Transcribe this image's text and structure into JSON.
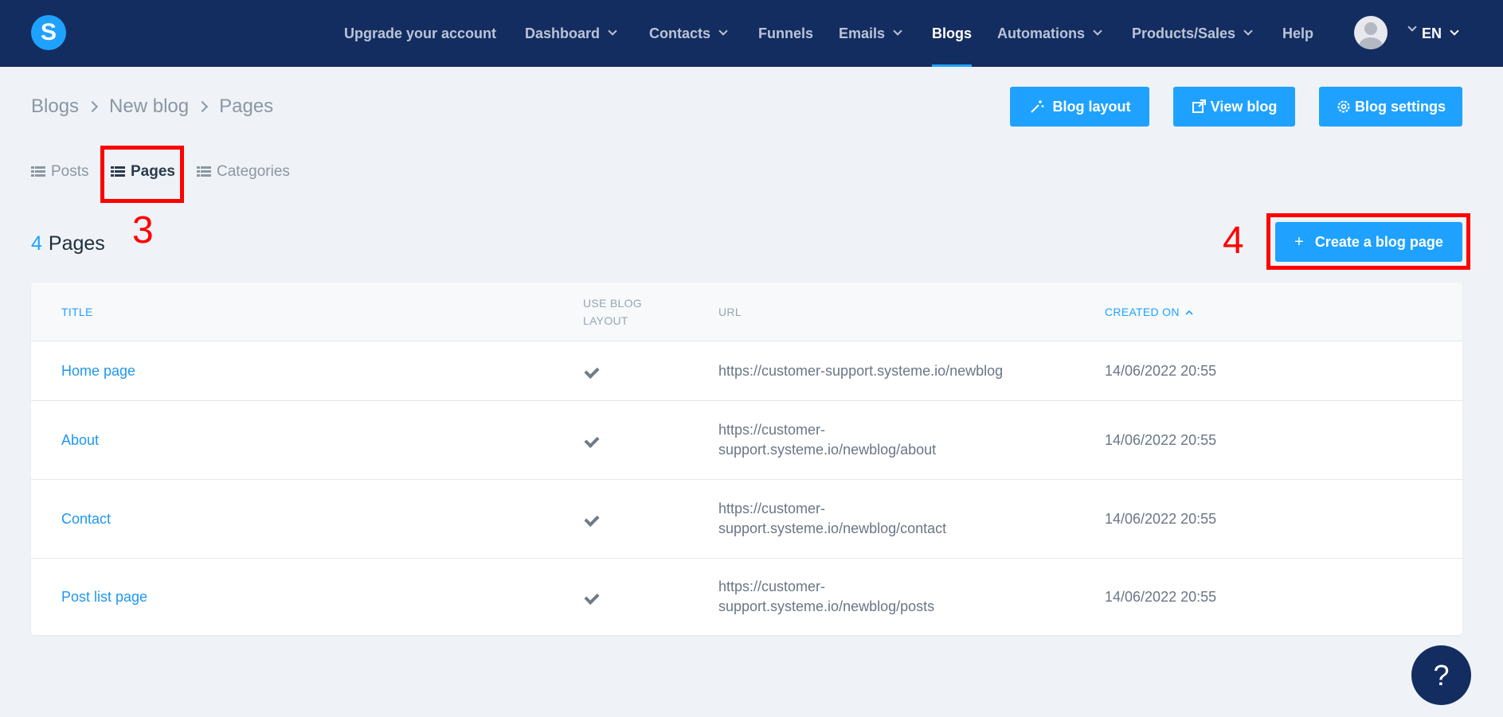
{
  "nav": {
    "logo": "S",
    "items": [
      {
        "label": "Upgrade your account"
      },
      {
        "label": "Dashboard"
      },
      {
        "label": "Contacts"
      },
      {
        "label": "Funnels"
      },
      {
        "label": "Emails"
      },
      {
        "label": "Blogs"
      },
      {
        "label": "Automations"
      },
      {
        "label": "Products/Sales"
      },
      {
        "label": "Help"
      }
    ],
    "active": "Blogs",
    "language": "EN"
  },
  "breadcrumb": [
    "Blogs",
    "New blog",
    "Pages"
  ],
  "actions": {
    "blog_layout": "Blog layout",
    "view_blog": "View blog",
    "blog_settings": "Blog settings",
    "create": "Create a blog page",
    "create_icon": "+"
  },
  "tabs": [
    {
      "label": "Posts"
    },
    {
      "label": "Pages"
    },
    {
      "label": "Categories"
    }
  ],
  "active_tab": "Pages",
  "annotations": {
    "step3": "3",
    "step4": "4"
  },
  "summary": {
    "count": "4",
    "label": "Pages"
  },
  "table": {
    "headers": {
      "title": "TITLE",
      "use_blog_layout_1": "USE BLOG",
      "use_blog_layout_2": "LAYOUT",
      "url": "URL",
      "created_on": "CREATED ON"
    },
    "rows": [
      {
        "title": "Home page",
        "use_blog_layout": true,
        "url_1": "https://customer-support.systeme.io/newblog",
        "url_2": "",
        "created_on": "14/06/2022 20:55"
      },
      {
        "title": "About",
        "use_blog_layout": true,
        "url_1": "https://customer-",
        "url_2": "support.systeme.io/newblog/about",
        "created_on": "14/06/2022 20:55"
      },
      {
        "title": "Contact",
        "use_blog_layout": true,
        "url_1": "https://customer-",
        "url_2": "support.systeme.io/newblog/contact",
        "created_on": "14/06/2022 20:55"
      },
      {
        "title": "Post list page",
        "use_blog_layout": true,
        "url_1": "https://customer-",
        "url_2": "support.systeme.io/newblog/posts",
        "created_on": "14/06/2022 20:55"
      }
    ]
  },
  "help_button": "?"
}
